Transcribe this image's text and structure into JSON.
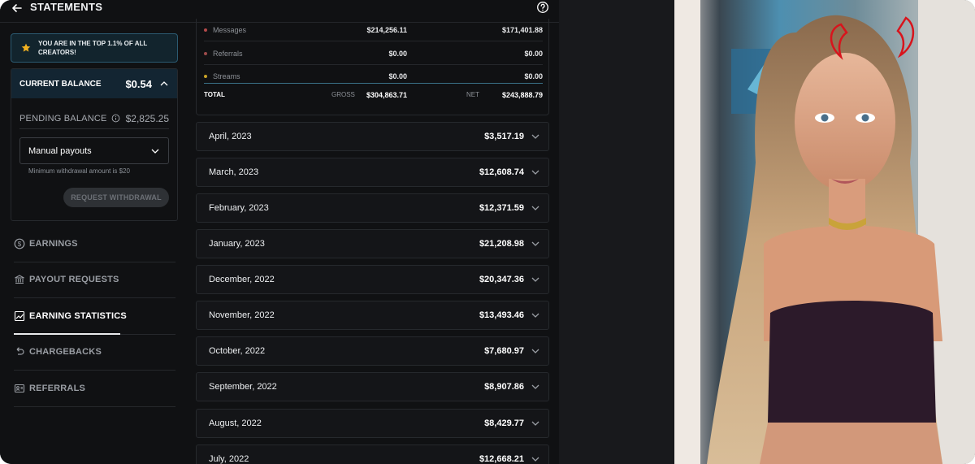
{
  "header": {
    "title": "STATEMENTS"
  },
  "sidebar": {
    "banner": "YOU ARE IN THE TOP 1.1% OF ALL CREATORS!",
    "current_balance_label": "CURRENT BALANCE",
    "current_balance_value": "$0.54",
    "pending_label": "PENDING BALANCE",
    "pending_value": "$2,825.25",
    "payouts_select": "Manual payouts",
    "min_note": "Minimum withdrawal amount is $20",
    "withdraw_button": "REQUEST WITHDRAWAL",
    "nav": [
      {
        "label": "EARNINGS",
        "icon": "dollar-circle-icon"
      },
      {
        "label": "PAYOUT REQUESTS",
        "icon": "bank-icon"
      },
      {
        "label": "EARNING STATISTICS",
        "icon": "chart-icon",
        "active": true
      },
      {
        "label": "CHARGEBACKS",
        "icon": "undo-icon"
      },
      {
        "label": "REFERRALS",
        "icon": "id-card-icon"
      }
    ]
  },
  "summary": {
    "rows": [
      {
        "name": "Messages",
        "gross": "$214,256.11",
        "net": "$171,401.88",
        "dot_color": "#b44a4a"
      },
      {
        "name": "Referrals",
        "gross": "$0.00",
        "net": "$0.00",
        "dot_color": "#9c4a4a"
      },
      {
        "name": "Streams",
        "gross": "$0.00",
        "net": "$0.00",
        "dot_color": "#c9a227"
      }
    ],
    "total_label": "TOTAL",
    "gross_label": "GROSS",
    "gross_value": "$304,863.71",
    "net_label": "NET",
    "net_value": "$243,888.79"
  },
  "months": [
    {
      "name": "April, 2023",
      "value": "$3,517.19"
    },
    {
      "name": "March, 2023",
      "value": "$12,608.74"
    },
    {
      "name": "February, 2023",
      "value": "$12,371.59"
    },
    {
      "name": "January, 2023",
      "value": "$21,208.98"
    },
    {
      "name": "December, 2022",
      "value": "$20,347.36"
    },
    {
      "name": "November, 2022",
      "value": "$13,493.46"
    },
    {
      "name": "October, 2022",
      "value": "$7,680.97"
    },
    {
      "name": "September, 2022",
      "value": "$8,907.86"
    },
    {
      "name": "August, 2022",
      "value": "$8,429.77"
    },
    {
      "name": "July, 2022",
      "value": "$12,668.21"
    }
  ],
  "colors": {
    "accent_banner": "#12242d",
    "balance_header": "#132532",
    "star": "#f0b020"
  }
}
